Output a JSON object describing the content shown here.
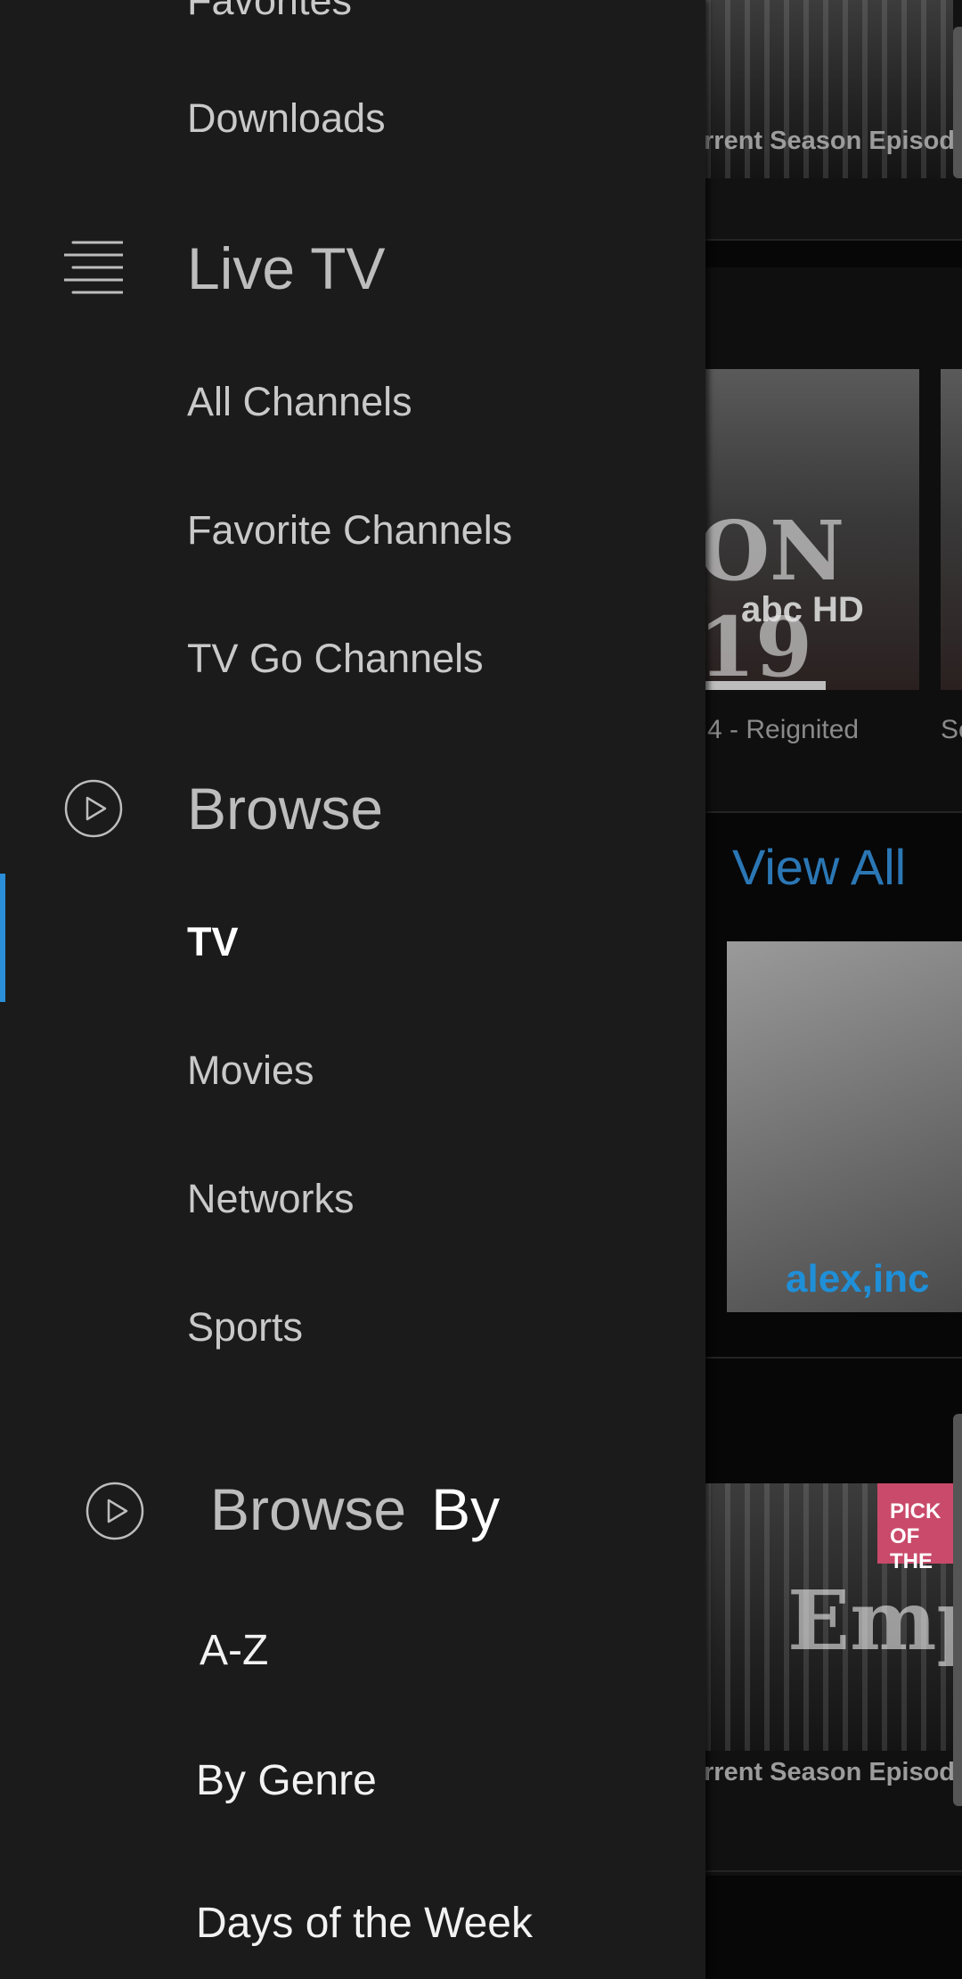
{
  "drawer": {
    "top_partial_item": "Favorites",
    "downloads_label": "Downloads",
    "live_tv": {
      "title": "Live TV",
      "icon": "guide-lines-icon",
      "items": [
        "All Channels",
        "Favorite Channels",
        "TV Go Channels"
      ]
    },
    "browse": {
      "title": "Browse",
      "icon": "play-circle-icon",
      "items": [
        "TV",
        "Movies",
        "Networks",
        "Sports"
      ],
      "active_item": "TV"
    },
    "browse_by": {
      "title_part1": "Browse",
      "title_part2": "By",
      "icon": "play-circle-icon",
      "items": [
        "A-Z",
        "By Genre",
        "Days of the Week"
      ]
    }
  },
  "background": {
    "caption_top": "rrent Season Episode",
    "thumb_station_text": "ON 19",
    "thumb_station_logo": "abc HD",
    "caption_mid": "4 - Reignited",
    "caption_mid_right": "Se",
    "view_all": "View All",
    "thumb_alex_logo": "alex,inc",
    "pick_badge": "PICK OF THE",
    "thumb_empire_text": "Empir",
    "caption_bottom": "rrent Season Episode"
  },
  "colors": {
    "drawer_bg": "#1b1b1b",
    "active_indicator": "#2a8fd8",
    "view_all": "#2b77b5"
  }
}
